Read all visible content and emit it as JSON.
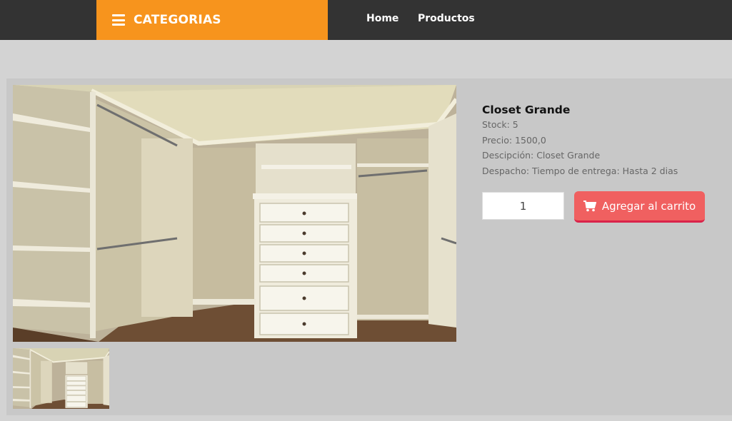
{
  "header": {
    "categories_label": "CATEGORIAS",
    "nav": [
      {
        "label": "Home"
      },
      {
        "label": "Productos"
      }
    ]
  },
  "product": {
    "title": "Closet Grande",
    "stock": "Stock: 5",
    "price": "Precio: 1500,0",
    "description": "Descipción: Closet Grande",
    "shipping": "Despacho: Tiempo de entrega: Hasta 2 dias",
    "quantity": "1",
    "add_to_cart_label": "Agregar al carrito"
  },
  "icons": {
    "menu": "hamburger-menu-icon",
    "cart": "shopping-cart-icon"
  },
  "colors": {
    "topbar": "#333333",
    "categories_bg": "#f7941d",
    "cart_button": "#f06060",
    "cart_button_border": "#d9234a",
    "page_bg": "#d3d3d3"
  }
}
